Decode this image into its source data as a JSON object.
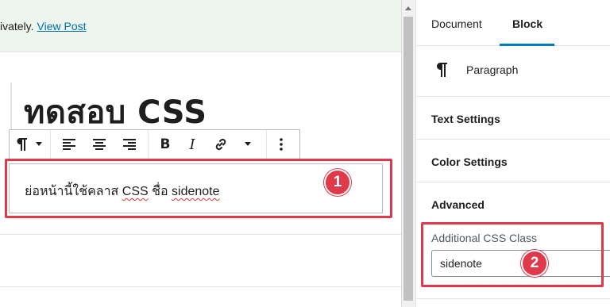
{
  "notice": {
    "message": "ivately.",
    "link": "View Post"
  },
  "post": {
    "title": "ทดสอบ CSS",
    "paragraph": {
      "before": "ย่อหน้านี้ใช้คลาส ",
      "word1": "CSS",
      "middle": " ชื่อ ",
      "word2": "sidenote"
    }
  },
  "toolbar": {
    "icons": [
      "paragraph-icon",
      "chevron-down-icon",
      "align-left-icon",
      "align-center-icon",
      "align-right-icon",
      "bold-icon",
      "italic-icon",
      "link-icon",
      "chevron-down-icon",
      "more-vertical-icon"
    ]
  },
  "sidebar": {
    "tabs": [
      "Document",
      "Block"
    ],
    "active_tab": "Block",
    "block_name": "Paragraph",
    "panels": [
      "Text Settings",
      "Color Settings",
      "Advanced"
    ],
    "advanced": {
      "field_label": "Additional CSS Class",
      "field_value": "sidenote"
    }
  },
  "annotations": {
    "badge1": "1",
    "badge2": "2"
  },
  "colors": {
    "accent": "#007cba",
    "annotation": "#e0394a",
    "notice_bg": "#edf5ee",
    "link": "#0073aa"
  }
}
